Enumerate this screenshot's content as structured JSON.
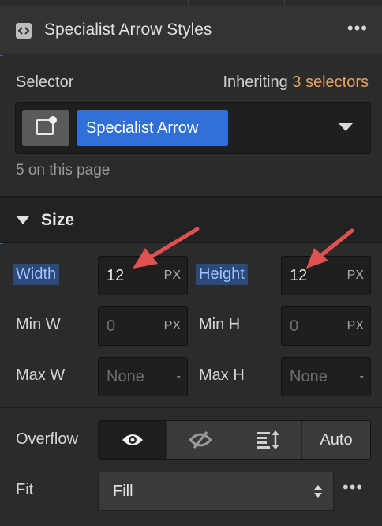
{
  "header": {
    "title": "Specialist Arrow Styles",
    "more_label": "•••"
  },
  "selector": {
    "label": "Selector",
    "inheriting_prefix": "Inheriting",
    "inheriting_count": "3 selectors",
    "chip_label": "Specialist Arrow",
    "on_page": "5 on this page"
  },
  "size": {
    "section_label": "Size",
    "width": {
      "label": "Width",
      "value": "12",
      "unit": "PX"
    },
    "height": {
      "label": "Height",
      "value": "12",
      "unit": "PX"
    },
    "min_w": {
      "label": "Min W",
      "value": "0",
      "unit": "PX"
    },
    "min_h": {
      "label": "Min H",
      "value": "0",
      "unit": "PX"
    },
    "max_w": {
      "label": "Max W",
      "value": "None",
      "unit": "-"
    },
    "max_h": {
      "label": "Max H",
      "value": "None",
      "unit": "-"
    }
  },
  "overflow": {
    "label": "Overflow",
    "options": [
      "visible-icon",
      "hidden-icon",
      "scroll-icon",
      "Auto"
    ],
    "selected_index": 0
  },
  "fit": {
    "label": "Fit",
    "value": "Fill",
    "more_label": "•••"
  },
  "colors": {
    "accent_blue": "#2f6fd6",
    "inherit_orange": "#e8a25b",
    "annotation_red": "#e05252"
  }
}
